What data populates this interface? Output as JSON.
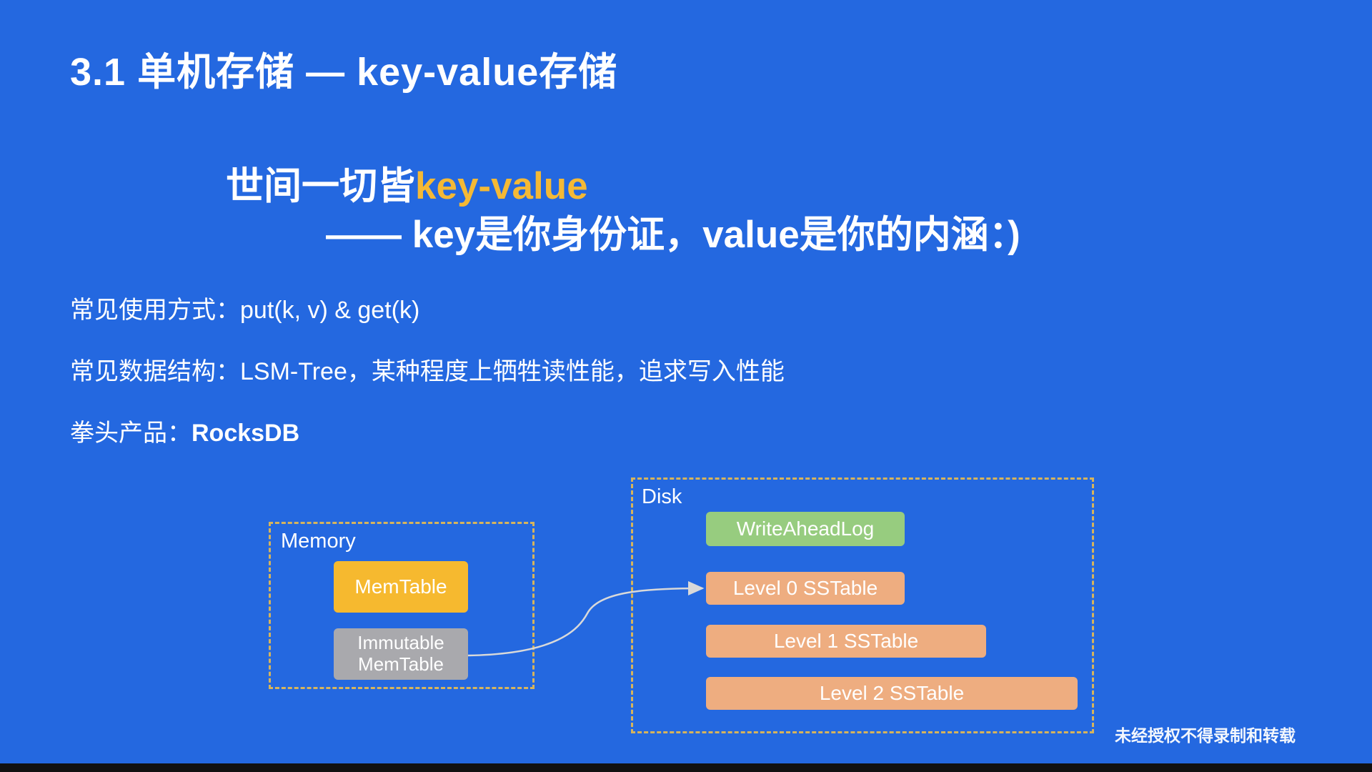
{
  "slide": {
    "title": "3.1 单机存储 — key-value存储",
    "quote": {
      "line1_prefix": "世间一切皆",
      "line1_highlight": "key-value",
      "line2": "—— key是你身份证，value是你的内涵：)"
    },
    "bullets": [
      {
        "label": "常见使用方式：",
        "value": "put(k, v) & get(k)"
      },
      {
        "label": "常见数据结构：",
        "value": "LSM-Tree，某种程度上牺牲读性能，追求写入性能"
      },
      {
        "label": "拳头产品：",
        "value": "RocksDB"
      }
    ]
  },
  "diagram": {
    "memory": {
      "label": "Memory",
      "memtable": "MemTable",
      "immutable_line1": "Immutable",
      "immutable_line2": "MemTable"
    },
    "disk": {
      "label": "Disk",
      "wal": "WriteAheadLog",
      "level0": "Level 0 SSTable",
      "level1": "Level 1 SSTable",
      "level2": "Level 2 SSTable"
    }
  },
  "watermark": "未经授权不得录制和转载",
  "colors": {
    "background": "#2468E0",
    "highlight": "#F5B935",
    "memtable": "#F6B92F",
    "immutable": "#A9A9AD",
    "wal": "#97CC7F",
    "sstable": "#EEAD80",
    "dashed_border": "#D6B45C"
  }
}
